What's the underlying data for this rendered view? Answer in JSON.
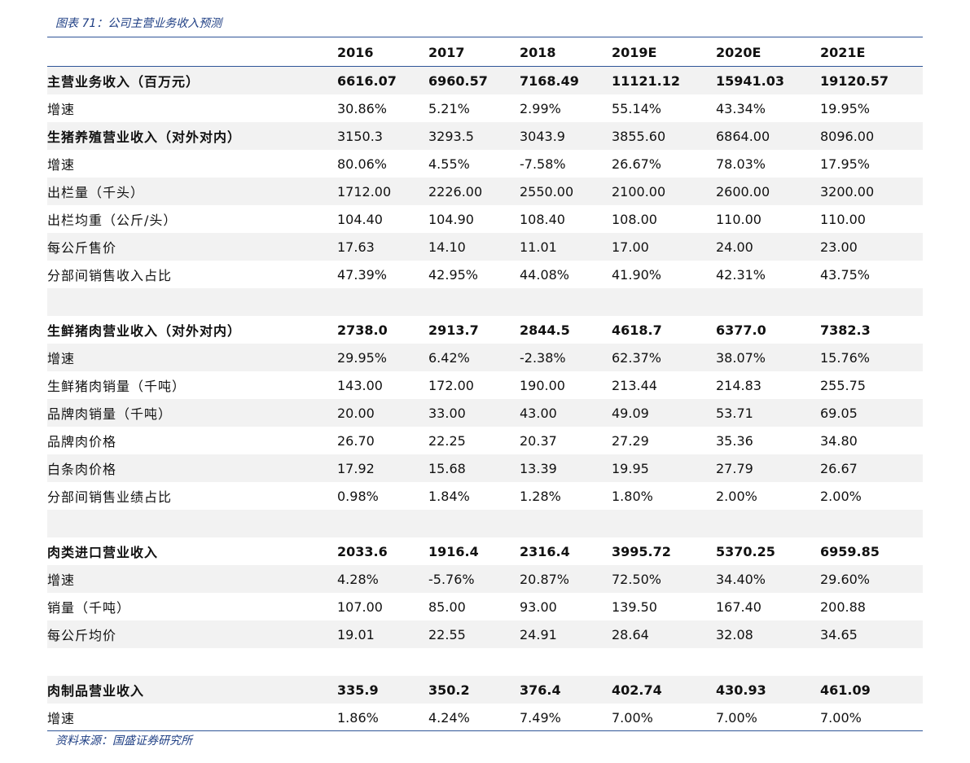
{
  "figure_title": "图表 71：公司主营业务收入预测",
  "source_note": "资料来源：国盛证券研究所",
  "columns": [
    "2016",
    "2017",
    "2018",
    "2019E",
    "2020E",
    "2021E"
  ],
  "rows": [
    {
      "label": "主营业务收入（百万元）",
      "values": [
        "6616.07",
        "6960.57",
        "7168.49",
        "11121.12",
        "15941.03",
        "19120.57"
      ]
    },
    {
      "label": "增速",
      "values": [
        "30.86%",
        "5.21%",
        "2.99%",
        "55.14%",
        "43.34%",
        "19.95%"
      ]
    },
    {
      "label": "生猪养殖营业收入（对外对内）",
      "values": [
        "3150.3",
        "3293.5",
        "3043.9",
        "3855.60",
        "6864.00",
        "8096.00"
      ]
    },
    {
      "label": "增速",
      "values": [
        "80.06%",
        "4.55%",
        "-7.58%",
        "26.67%",
        "78.03%",
        "17.95%"
      ]
    },
    {
      "label": "出栏量（千头）",
      "values": [
        "1712.00",
        "2226.00",
        "2550.00",
        "2100.00",
        "2600.00",
        "3200.00"
      ]
    },
    {
      "label": "出栏均重（公斤/头）",
      "values": [
        "104.40",
        "104.90",
        "108.40",
        "108.00",
        "110.00",
        "110.00"
      ]
    },
    {
      "label": "每公斤售价",
      "values": [
        "17.63",
        "14.10",
        "11.01",
        "17.00",
        "24.00",
        "23.00"
      ]
    },
    {
      "label": "分部间销售收入占比",
      "values": [
        "47.39%",
        "42.95%",
        "44.08%",
        "41.90%",
        "42.31%",
        "43.75%"
      ]
    },
    {
      "label": "生鲜猪肉营业收入（对外对内）",
      "values": [
        "2738.0",
        "2913.7",
        "2844.5",
        "4618.7",
        "6377.0",
        "7382.3"
      ]
    },
    {
      "label": "增速",
      "values": [
        "29.95%",
        "6.42%",
        "-2.38%",
        "62.37%",
        "38.07%",
        "15.76%"
      ]
    },
    {
      "label": "生鲜猪肉销量（千吨）",
      "values": [
        "143.00",
        "172.00",
        "190.00",
        "213.44",
        "214.83",
        "255.75"
      ]
    },
    {
      "label": "品牌肉销量（千吨）",
      "values": [
        "20.00",
        "33.00",
        "43.00",
        "49.09",
        "53.71",
        "69.05"
      ]
    },
    {
      "label": "品牌肉价格",
      "values": [
        "26.70",
        "22.25",
        "20.37",
        "27.29",
        "35.36",
        "34.80"
      ]
    },
    {
      "label": "白条肉价格",
      "values": [
        "17.92",
        "15.68",
        "13.39",
        "19.95",
        "27.79",
        "26.67"
      ]
    },
    {
      "label": "分部间销售业绩占比",
      "values": [
        "0.98%",
        "1.84%",
        "1.28%",
        "1.80%",
        "2.00%",
        "2.00%"
      ]
    },
    {
      "label": "肉类进口营业收入",
      "values": [
        "2033.6",
        "1916.4",
        "2316.4",
        "3995.72",
        "5370.25",
        "6959.85"
      ]
    },
    {
      "label": "增速",
      "values": [
        "4.28%",
        "-5.76%",
        "20.87%",
        "72.50%",
        "34.40%",
        "29.60%"
      ]
    },
    {
      "label": "销量（千吨）",
      "values": [
        "107.00",
        "85.00",
        "93.00",
        "139.50",
        "167.40",
        "200.88"
      ]
    },
    {
      "label": "每公斤均价",
      "values": [
        "19.01",
        "22.55",
        "24.91",
        "28.64",
        "32.08",
        "34.65"
      ]
    },
    {
      "label": "肉制品营业收入",
      "values": [
        "335.9",
        "350.2",
        "376.4",
        "402.74",
        "430.93",
        "461.09"
      ]
    },
    {
      "label": "增速",
      "values": [
        "1.86%",
        "4.24%",
        "7.49%",
        "7.00%",
        "7.00%",
        "7.00%"
      ]
    }
  ]
}
